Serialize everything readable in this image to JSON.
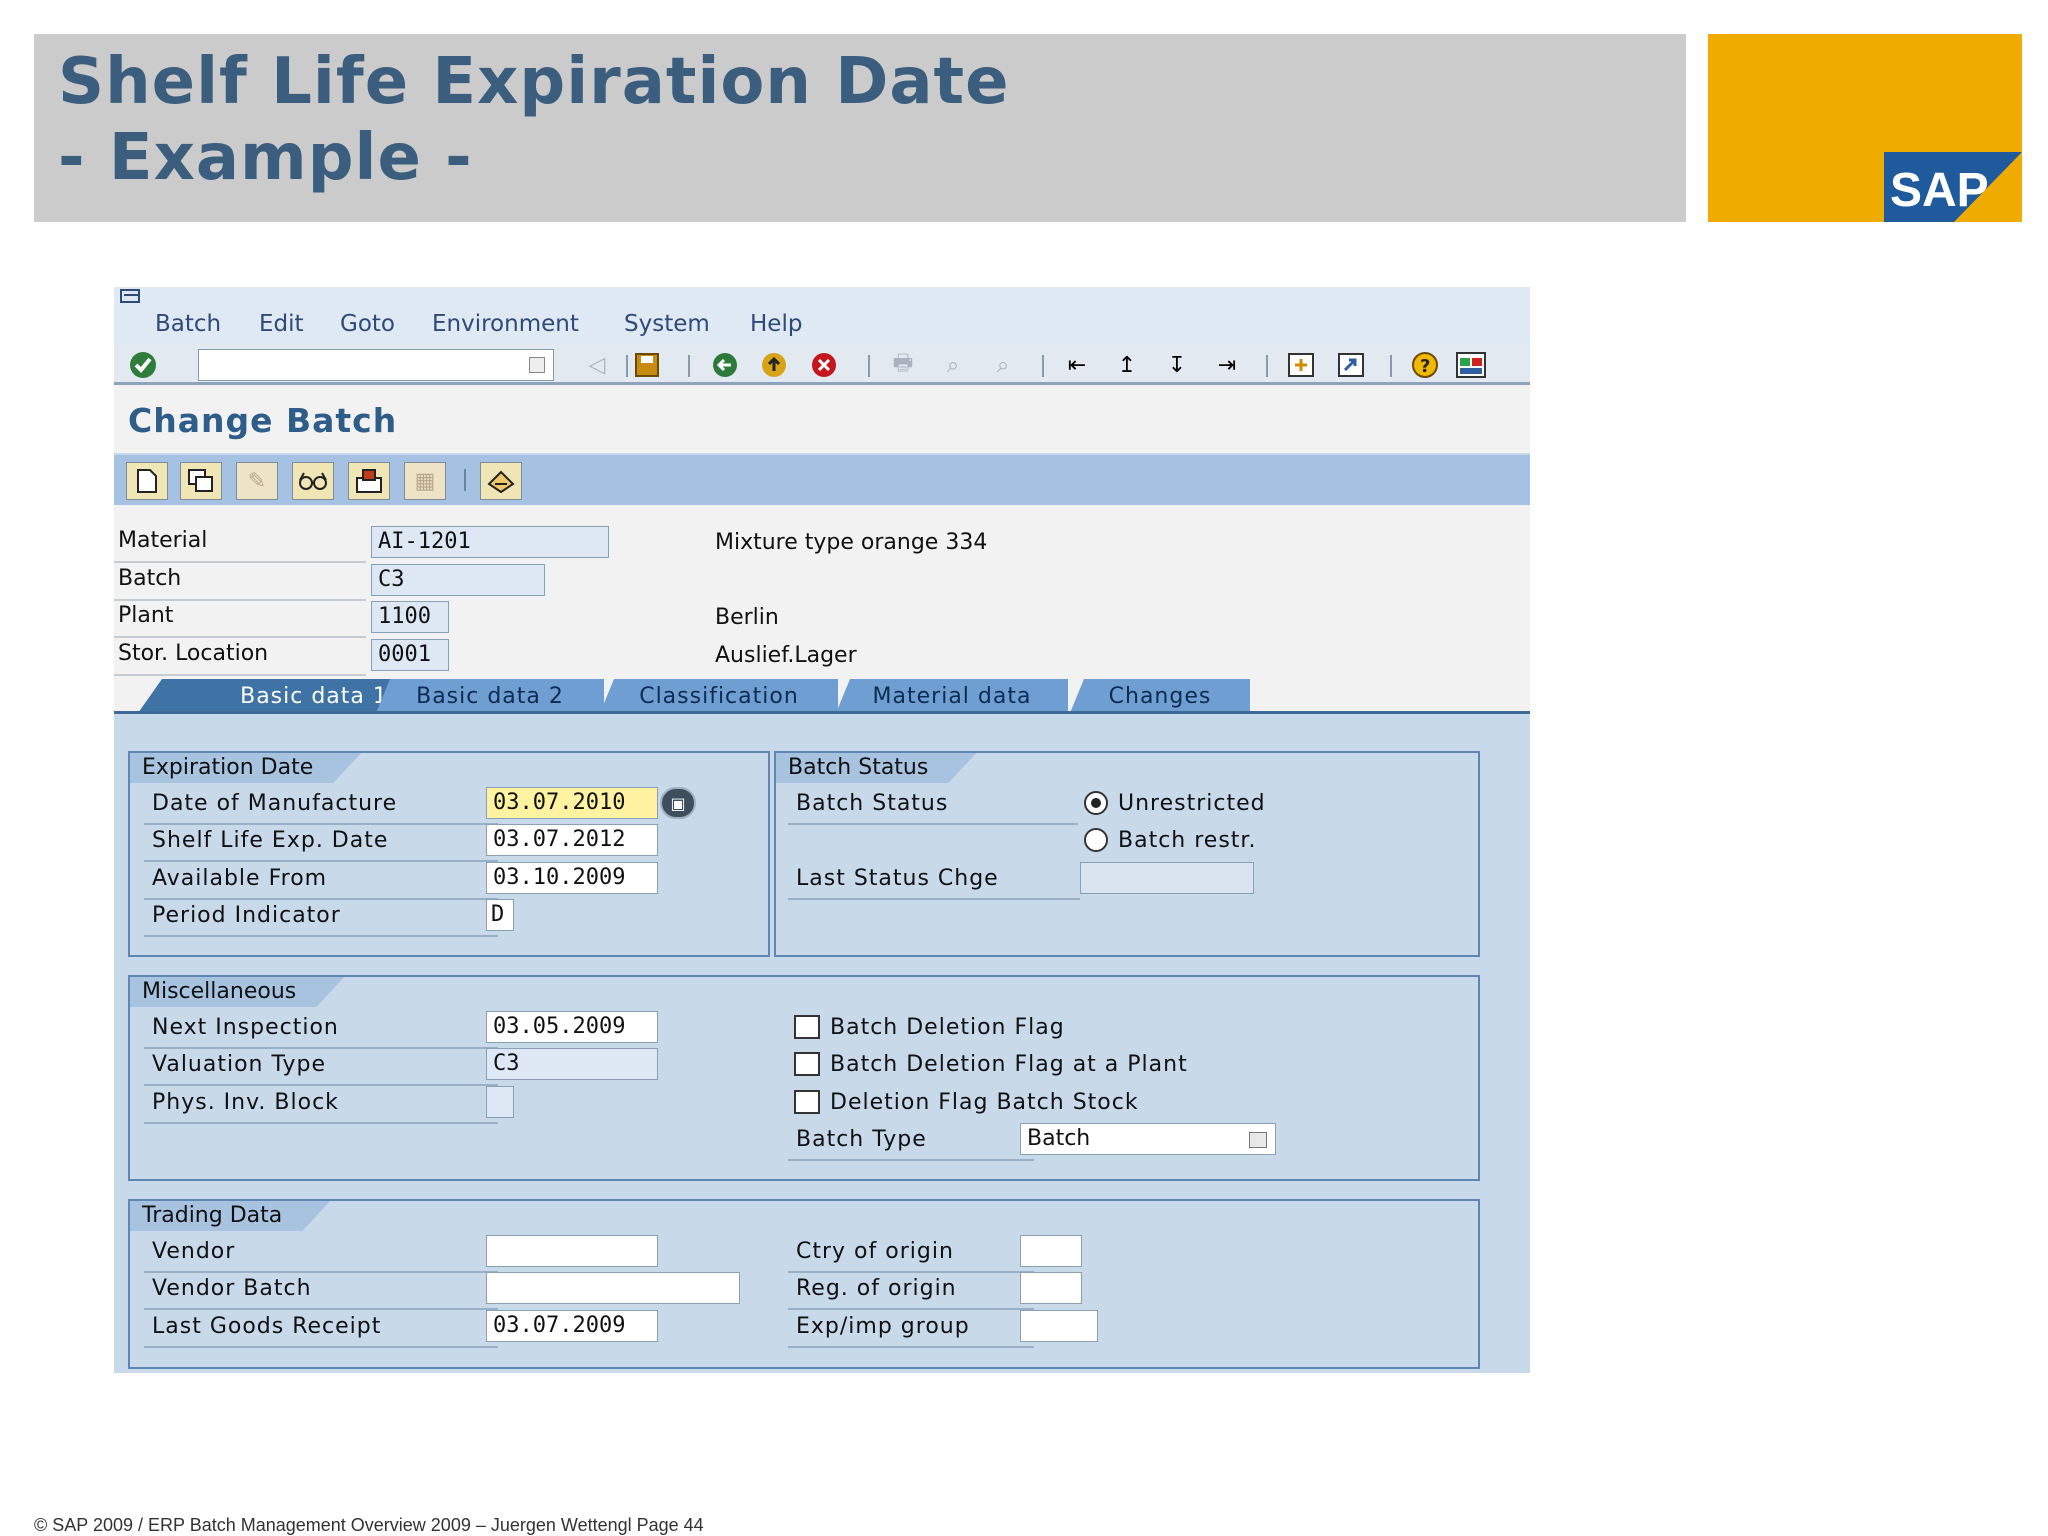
{
  "slide": {
    "title_line1": "Shelf Life Expiration Date",
    "title_line2": "- Example -",
    "logo_text": "SAP",
    "footer": "© SAP 2009 / ERP Batch Management Overview  2009 – Juergen Wettengl Page 44",
    "colors": {
      "header_bg": "#cbcbcb",
      "title": "#3b5e7e",
      "brand_box": "#efab00",
      "logo_blue": "#1f5a9c"
    }
  },
  "menu": [
    "Batch",
    "Edit",
    "Goto",
    "Environment",
    "System",
    "Help"
  ],
  "toolbar": {
    "command_value": "",
    "icons": [
      "enter-icon",
      "back-arrow-icon",
      "save-icon",
      "back-icon",
      "exit-icon",
      "cancel-icon",
      "print-icon",
      "find-icon",
      "find-next-icon",
      "first-page-icon",
      "previous-page-icon",
      "next-page-icon",
      "last-page-icon",
      "create-session-icon",
      "shortcut-icon",
      "help-icon",
      "layout-icon"
    ]
  },
  "screen_title": "Change Batch",
  "app_toolbar_icons": [
    "create-icon",
    "copy-icon",
    "change-icon",
    "display-icon",
    "classification-icon",
    "where-used-icon",
    "print-batch-icon"
  ],
  "header": {
    "material": {
      "label": "Material",
      "value": "AI-1201",
      "desc": "Mixture type orange 334"
    },
    "batch": {
      "label": "Batch",
      "value": "C3"
    },
    "plant": {
      "label": "Plant",
      "value": "1100",
      "desc": "Berlin"
    },
    "stor_location": {
      "label": "Stor. Location",
      "value": "0001",
      "desc": "Auslief.Lager"
    }
  },
  "tabs": [
    "Basic data 1",
    "Basic data 2",
    "Classification",
    "Material data",
    "Changes"
  ],
  "active_tab": "Basic data 1",
  "expiration": {
    "title": "Expiration Date",
    "date_of_manufacture": {
      "label": "Date of Manufacture",
      "value": "03.07.2010"
    },
    "shelf_life_exp_date": {
      "label": "Shelf Life Exp. Date",
      "value": "03.07.2012"
    },
    "available_from": {
      "label": "Available From",
      "value": "03.10.2009"
    },
    "period_indicator": {
      "label": "Period Indicator",
      "value": "D"
    }
  },
  "batch_status": {
    "title": "Batch Status",
    "label": "Batch Status",
    "unrestricted": "Unrestricted",
    "restricted": "Batch restr.",
    "selected": "Unrestricted",
    "last_status_change": {
      "label": "Last Status Chge",
      "value": ""
    }
  },
  "misc": {
    "title": "Miscellaneous",
    "next_inspection": {
      "label": "Next Inspection",
      "value": "03.05.2009"
    },
    "valuation_type": {
      "label": "Valuation Type",
      "value": "C3"
    },
    "phys_inv_block": {
      "label": "Phys. Inv. Block",
      "value": ""
    },
    "deletion_flag": "Batch Deletion Flag",
    "deletion_flag_plant": "Batch Deletion Flag at a Plant",
    "deletion_flag_stock": "Deletion Flag Batch Stock",
    "batch_type": {
      "label": "Batch Type",
      "value": "Batch"
    }
  },
  "trading": {
    "title": "Trading Data",
    "vendor": {
      "label": "Vendor",
      "value": ""
    },
    "vendor_batch": {
      "label": "Vendor Batch",
      "value": ""
    },
    "last_goods_receipt": {
      "label": "Last Goods Receipt",
      "value": "03.07.2009"
    },
    "ctry_origin": {
      "label": "Ctry of origin",
      "value": ""
    },
    "reg_origin": {
      "label": "Reg. of origin",
      "value": ""
    },
    "exp_imp_group": {
      "label": "Exp/imp group",
      "value": ""
    }
  }
}
